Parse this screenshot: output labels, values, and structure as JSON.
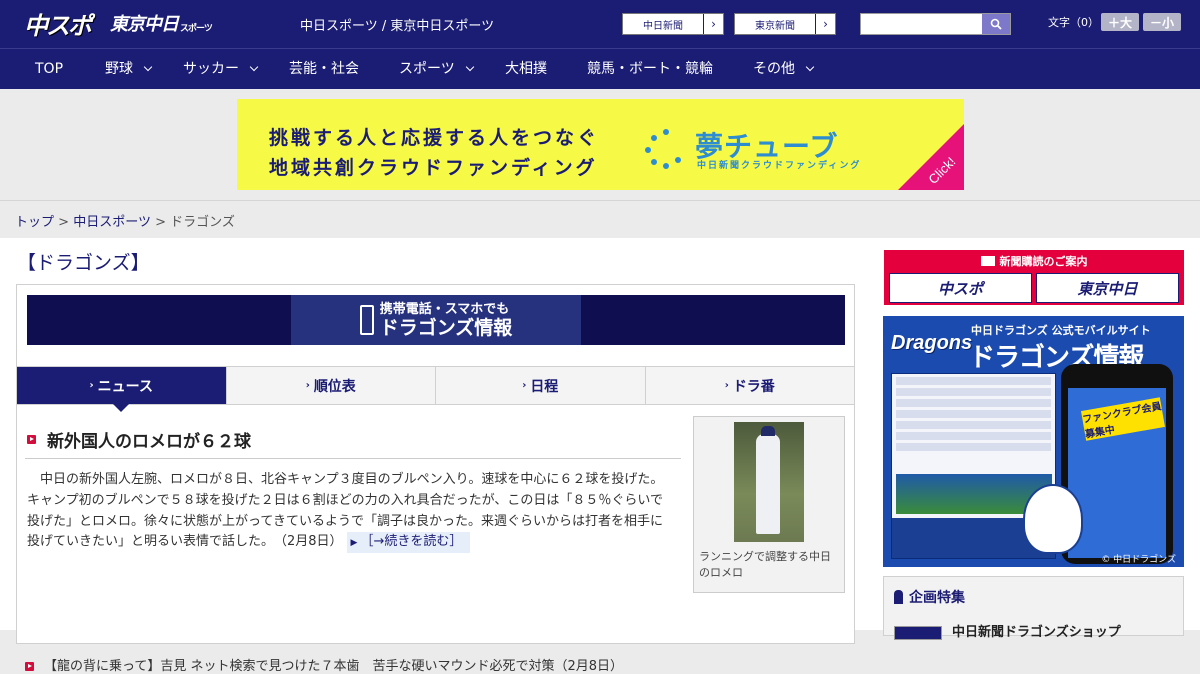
{
  "header": {
    "logo_chunichi_sports": "中スポ",
    "logo_tokyo_chunichi": "東京中日",
    "logo_tokyo_chunichi_small": "スポーツ",
    "site_name": "中日スポーツ / 東京中日スポーツ",
    "paper_buttons": [
      {
        "label": "中日新聞"
      },
      {
        "label": "東京新聞"
      }
    ],
    "search_placeholder": "",
    "font_size_label": "文字（0）",
    "font_larger": "＋大",
    "font_smaller": "－小"
  },
  "nav": {
    "items": [
      {
        "label": "TOP",
        "dropdown": false
      },
      {
        "label": "野球",
        "dropdown": true
      },
      {
        "label": "サッカー",
        "dropdown": true
      },
      {
        "label": "芸能・社会",
        "dropdown": false
      },
      {
        "label": "スポーツ",
        "dropdown": true
      },
      {
        "label": "大相撲",
        "dropdown": false
      },
      {
        "label": "競馬・ボート・競輪",
        "dropdown": false
      },
      {
        "label": "その他",
        "dropdown": true
      }
    ]
  },
  "ad_banner": {
    "line1": "挑戦する人と応援する人をつなぐ",
    "line2": "地域共創クラウドファンディング",
    "brand": "夢チューブ",
    "brand_sub": "中日新聞クラウドファンディング",
    "click": "Click!"
  },
  "breadcrumb": {
    "items": [
      "トップ",
      "中日スポーツ"
    ],
    "current": "ドラゴンズ",
    "separator": ">"
  },
  "page_title": "【ドラゴンズ】",
  "mobile_banner": {
    "line1": "携帯電話・スマホでも",
    "line2": "ドラゴンズ情報"
  },
  "tabs": [
    {
      "label": "ニュース",
      "active": true
    },
    {
      "label": "順位表",
      "active": false
    },
    {
      "label": "日程",
      "active": false
    },
    {
      "label": "ドラ番",
      "active": false
    }
  ],
  "article": {
    "headline": "新外国人のロメロが６２球",
    "body": "中日の新外国人左腕、ロメロが８日、北谷キャンプ３度目のブルペン入り。速球を中心に６２球を投げた。キャンプ初のブルペンで５８球を投げた２日は６割ほどの力の入れ具合だったが、この日は「８５％ぐらいで投げた」とロメロ。徐々に状態が上がってきているようで「調子は良かった。来週ぐらいからは打者を相手に投げていきたい」と明るい表情で話した。　（2月8日）",
    "read_more": "［→続きを読む］",
    "photo_caption": "ランニングで調整する中日のロメロ"
  },
  "related": [
    {
      "text": "【龍の背に乗って】吉見 ネット検索で見つけた７本歯　苦手な硬いマウンド必死で対策（2月8日）"
    }
  ],
  "sidebar": {
    "subscribe": {
      "title": "新聞購読のご案内",
      "paper1": "中スポ",
      "paper2": "東京中日"
    },
    "dragons_ad": {
      "logo": "Dragons",
      "line1": "中日ドラゴンズ 公式モバイルサイト",
      "line2": "ドラゴンズ情報",
      "badge": "ファンクラブ会員募集中",
      "copyright": "© 中日ドラゴンズ"
    },
    "feature": {
      "title": "企画特集",
      "item": "中日新聞ドラゴンズショップ"
    }
  },
  "colors": {
    "navy": "#1b1c73",
    "accent_red": "#d10e3c",
    "banner_yellow": "#f6fa47"
  }
}
